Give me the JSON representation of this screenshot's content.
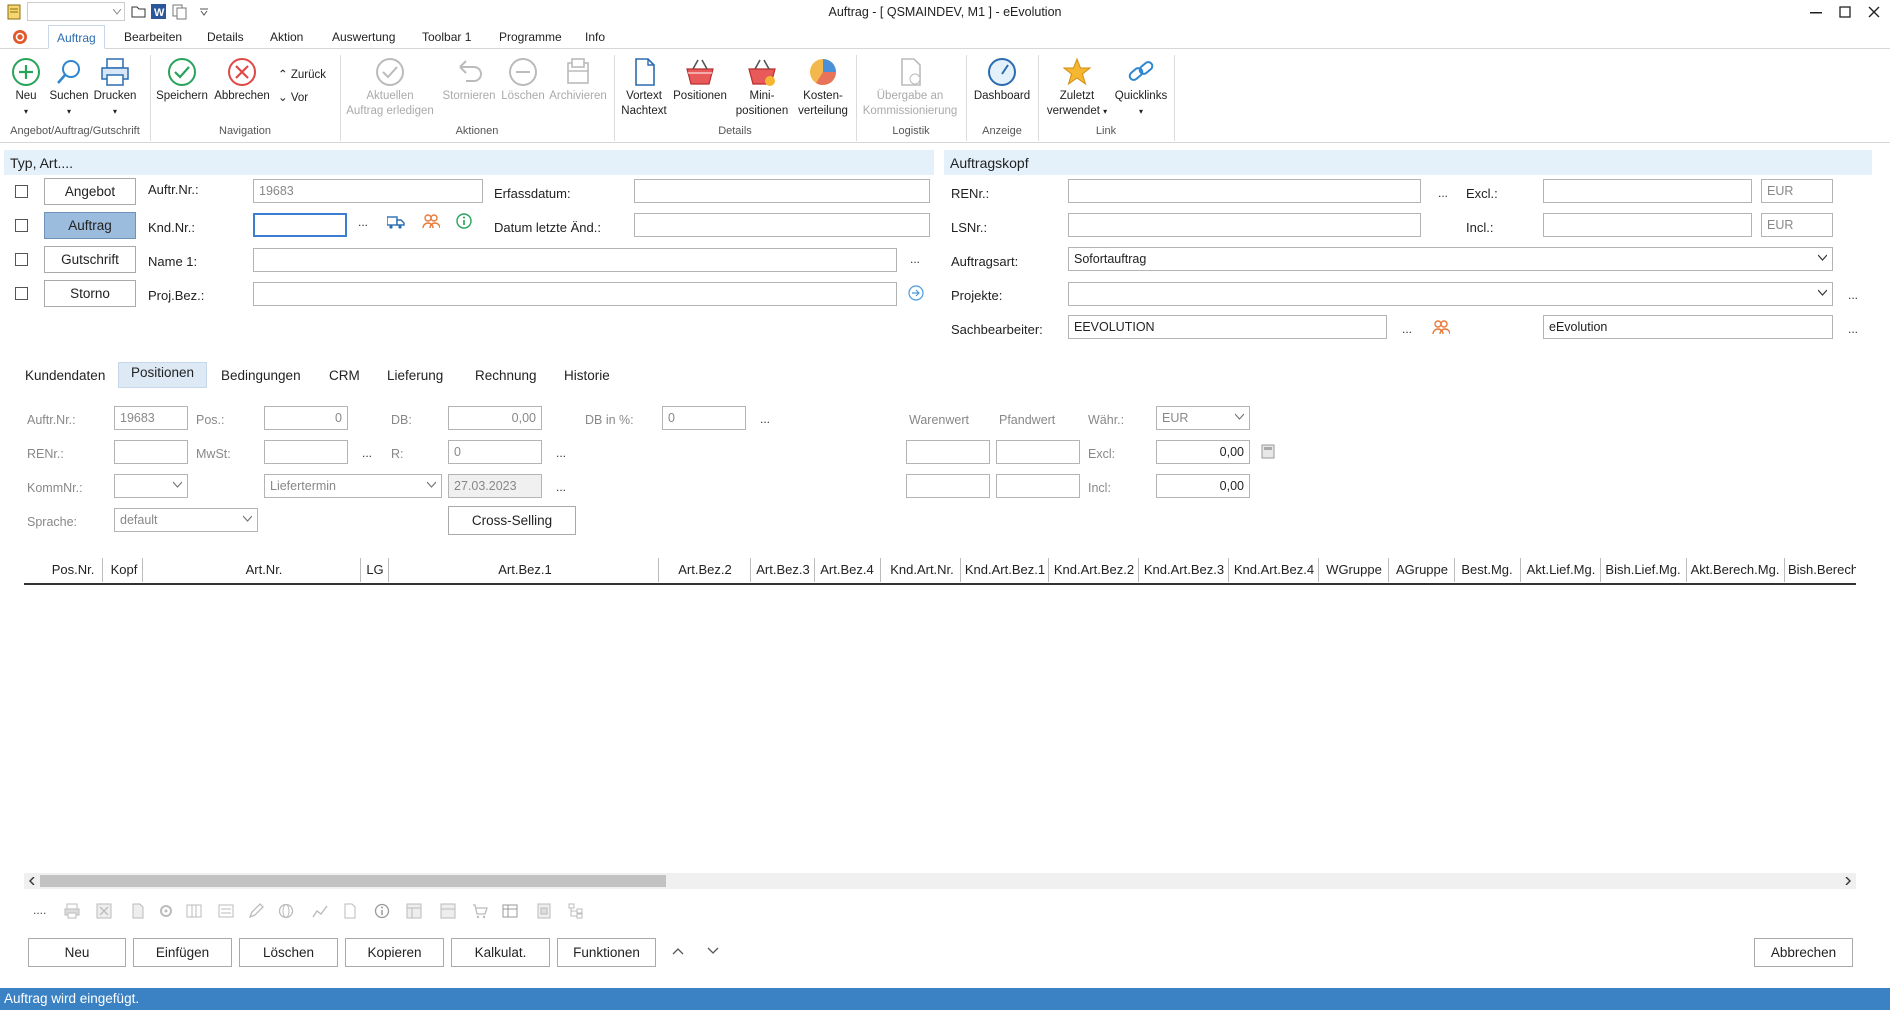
{
  "window": {
    "title": "Auftrag - [ QSMAINDEV, M1 ]  -  eEvolution"
  },
  "ribbon_tabs": [
    "Auftrag",
    "Bearbeiten",
    "Details",
    "Aktion",
    "Auswertung",
    "Toolbar 1",
    "Programme",
    "Info"
  ],
  "ribbon": {
    "new": "Neu",
    "search": "Suchen",
    "print": "Drucken",
    "save": "Speichern",
    "cancel": "Abbrechen",
    "back": "Zurück",
    "forward": "Vor",
    "complete_1": "Aktuellen",
    "complete_2": "Auftrag erledigen",
    "storno": "Stornieren",
    "delete": "Löschen",
    "archive": "Archivieren",
    "vortext_1": "Vortext",
    "vortext_2": "Nachtext",
    "positions": "Positionen",
    "mini_1": "Mini-",
    "mini_2": "positionen",
    "cost_1": "Kosten-",
    "cost_2": "verteilung",
    "handover_1": "Übergabe an",
    "handover_2": "Kommissionierung",
    "dashboard": "Dashboard",
    "recent_1": "Zuletzt",
    "recent_2": "verwendet",
    "quicklinks": "Quicklinks",
    "groups": {
      "g1": "Angebot/Auftrag/Gutschrift",
      "g2": "Navigation",
      "g3": "Aktionen",
      "g4": "Details",
      "g5": "Logistik",
      "g6": "Anzeige",
      "g7": "Link"
    }
  },
  "typ_panel": {
    "header": "Typ, Art....",
    "types": [
      "Angebot",
      "Auftrag",
      "Gutschrift",
      "Storno"
    ],
    "auftr_nr_label": "Auftr.Nr.:",
    "auftr_nr_value": "19683",
    "knd_nr_label": "Knd.Nr.:",
    "name1_label": "Name 1:",
    "projbez_label": "Proj.Bez.:",
    "erfassdatum_label": "Erfassdatum:",
    "datum_letzte_label": "Datum letzte Änd.:"
  },
  "kopf_panel": {
    "header": "Auftragskopf",
    "renr_label": "RENr.:",
    "lsnr_label": "LSNr.:",
    "excl_label": "Excl.:",
    "incl_label": "Incl.:",
    "currency": "EUR",
    "auftragsart_label": "Auftragsart:",
    "auftragsart_value": "Sofortauftrag",
    "projekte_label": "Projekte:",
    "sachbearbeiter_label": "Sachbearbeiter:",
    "sachbearbeiter_value": "EEVOLUTION",
    "sachbearbeiter_name": "eEvolution"
  },
  "page_tabs": [
    "Kundendaten",
    "Positionen",
    "Bedingungen",
    "CRM",
    "Lieferung",
    "Rechnung",
    "Historie"
  ],
  "positions_form": {
    "auftr_nr_label": "Auftr.Nr.:",
    "auftr_nr_value": "19683",
    "pos_label": "Pos.:",
    "pos_value": "0",
    "db_label": "DB:",
    "db_value": "0,00",
    "db_pct_label": "DB in %:",
    "db_pct_value": "0",
    "renr_label": "RENr.:",
    "mwst_label": "MwSt:",
    "r_label": "R:",
    "r_value": "0",
    "kommnr_label": "KommNr.:",
    "liefertermin_label": "Liefertermin",
    "liefertermin_value": "27.03.2023",
    "sprache_label": "Sprache:",
    "sprache_value": "default",
    "cross_selling": "Cross-Selling",
    "warenwert_label": "Warenwert",
    "pfandwert_label": "Pfandwert",
    "waehr_label": "Währ.:",
    "waehr_value": "EUR",
    "excl_label": "Excl:",
    "excl_value": "0,00",
    "incl_label": "Incl:",
    "incl_value": "0,00"
  },
  "grid_columns": [
    "Pos.Nr.",
    "Kopf",
    "Art.Nr.",
    "LG",
    "Art.Bez.1",
    "Art.Bez.2",
    "Art.Bez.3",
    "Art.Bez.4",
    "Knd.Art.Nr.",
    "Knd.Art.Bez.1",
    "Knd.Art.Bez.2",
    "Knd.Art.Bez.3",
    "Knd.Art.Bez.4",
    "WGruppe",
    "AGruppe",
    "Best.Mg.",
    "Akt.Lief.Mg.",
    "Bish.Lief.Mg.",
    "Akt.Berech.Mg.",
    "Bish.Berech"
  ],
  "bottom_buttons": {
    "neu": "Neu",
    "einfuegen": "Einfügen",
    "loeschen": "Löschen",
    "kopieren": "Kopieren",
    "kalkulat": "Kalkulat.",
    "funktionen": "Funktionen",
    "abbrechen": "Abbrechen"
  },
  "status": "Auftrag wird eingefügt.",
  "colors": {
    "accent": "#2b6cb0",
    "status_bar": "#3b82c4",
    "panel_header": "#e4f0fa",
    "selected_type": "#9bbcdd"
  }
}
